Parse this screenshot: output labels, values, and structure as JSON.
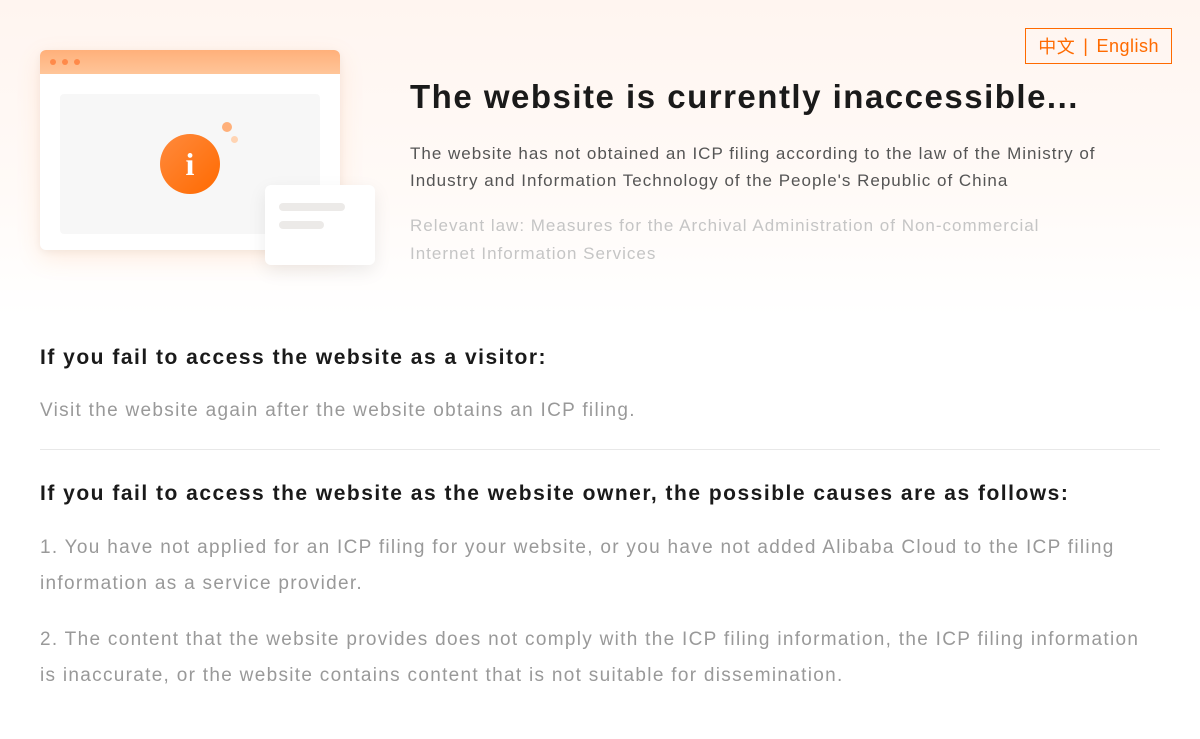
{
  "lang": {
    "chinese": "中文",
    "english": "English"
  },
  "hero": {
    "title": "The website is currently inaccessible...",
    "desc": "The website has not obtained an ICP filing according to the law of the Ministry of Industry and Information Technology of the People's Republic of China",
    "law": "Relevant law: Measures for the Archival Administration of Non-commercial Internet Information Services",
    "icon_letter": "i"
  },
  "visitor": {
    "heading": "If you fail to access the website as a visitor:",
    "body": "Visit the website again after the website obtains an ICP filing."
  },
  "owner": {
    "heading": "If you fail to access the website as the website owner, the possible causes are as follows:",
    "cause1": "1. You have not applied for an ICP filing for your website, or you have not added Alibaba Cloud to the ICP filing information as a service provider.",
    "cause2": "2. The content that the website provides does not comply with the ICP filing information, the ICP filing information is inaccurate, or the website contains content that is not suitable for dissemination."
  }
}
